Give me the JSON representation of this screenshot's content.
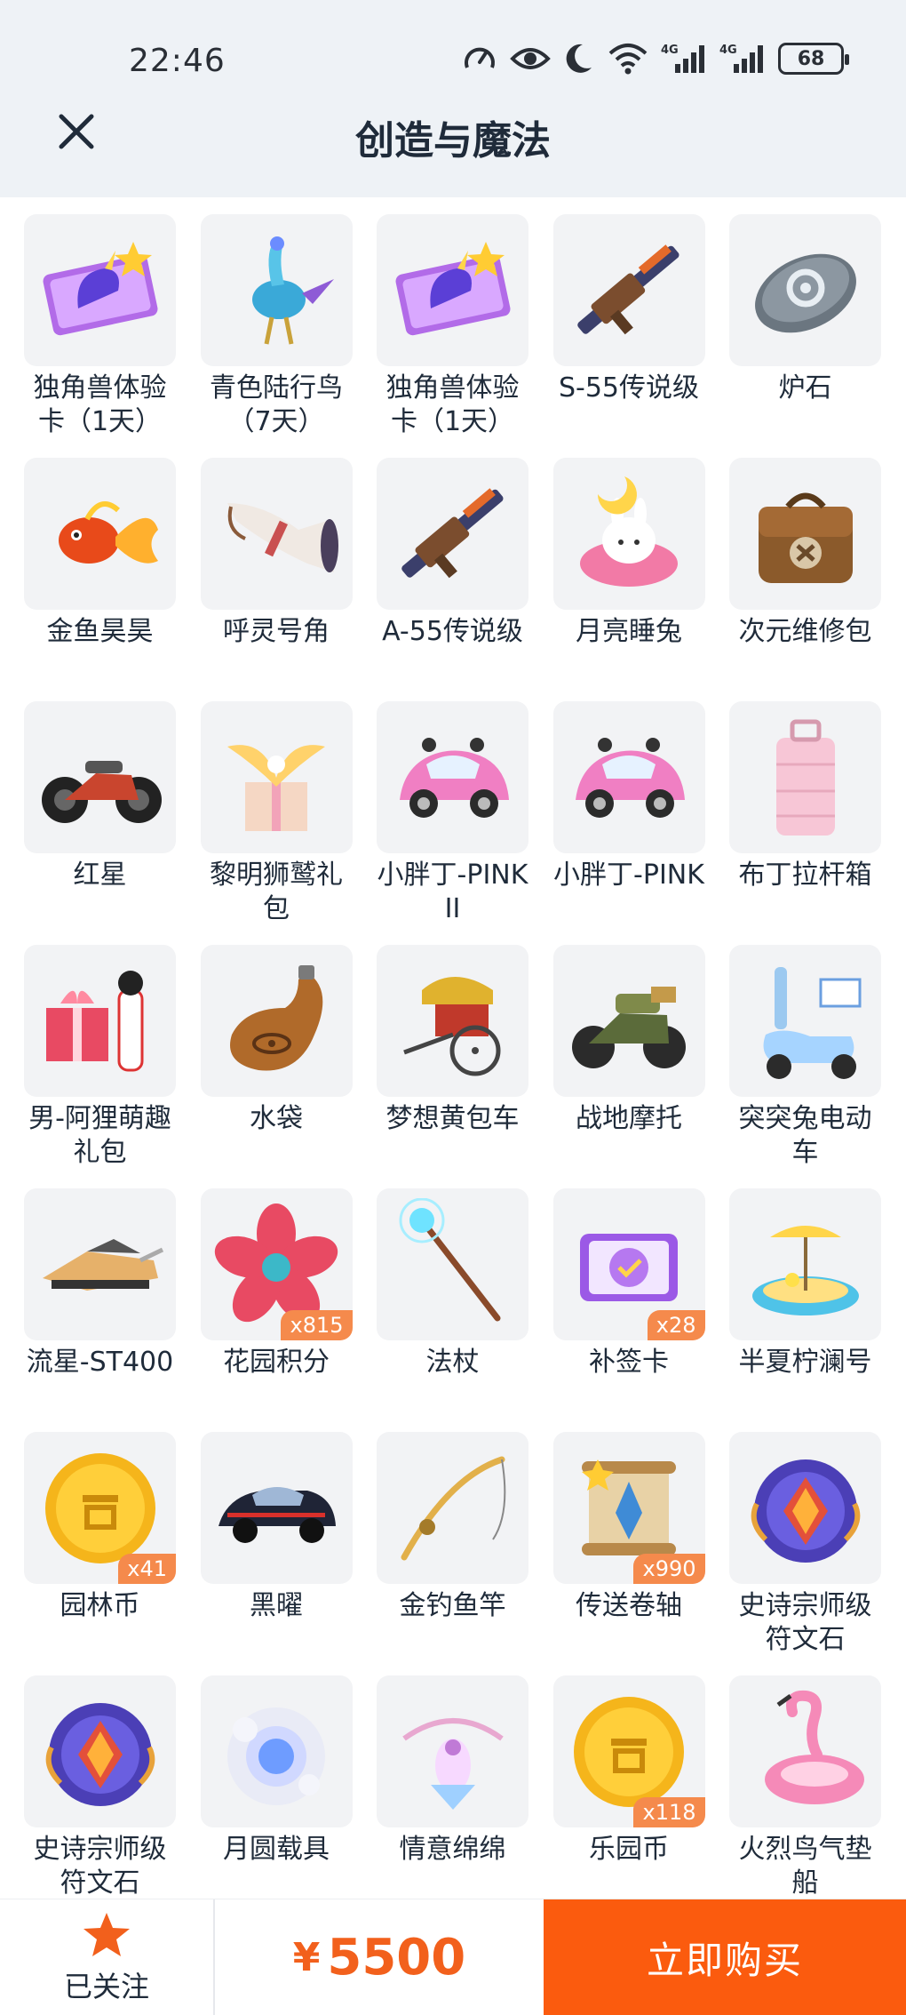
{
  "status": {
    "time": "22:46",
    "battery": "68",
    "net1": "4G",
    "net2": "4G"
  },
  "header": {
    "title": "创造与魔法"
  },
  "items": [
    {
      "name": "独角兽体验卡（1天）",
      "icon": "unicorn-card-icon",
      "badge": ""
    },
    {
      "name": "青色陆行鸟（7天）",
      "icon": "cyan-bird-icon",
      "badge": ""
    },
    {
      "name": "独角兽体验卡（1天）",
      "icon": "unicorn-card-icon",
      "badge": ""
    },
    {
      "name": "S-55传说级",
      "icon": "rifle-icon",
      "badge": ""
    },
    {
      "name": "炉石",
      "icon": "hearthstone-icon",
      "badge": ""
    },
    {
      "name": "金鱼昊昊",
      "icon": "goldfish-icon",
      "badge": ""
    },
    {
      "name": "呼灵号角",
      "icon": "horn-icon",
      "badge": ""
    },
    {
      "name": "A-55传说级",
      "icon": "rifle-icon",
      "badge": ""
    },
    {
      "name": "月亮睡兔",
      "icon": "moon-rabbit-icon",
      "badge": ""
    },
    {
      "name": "次元维修包",
      "icon": "repair-bag-icon",
      "badge": ""
    },
    {
      "name": "红星",
      "icon": "motorcycle-icon",
      "badge": ""
    },
    {
      "name": "黎明狮鹫礼包",
      "icon": "griffin-gift-icon",
      "badge": ""
    },
    {
      "name": "小胖丁-PINK II",
      "icon": "pink-car-icon",
      "badge": ""
    },
    {
      "name": "小胖丁-PINK",
      "icon": "pink-car-icon",
      "badge": ""
    },
    {
      "name": "布丁拉杆箱",
      "icon": "suitcase-icon",
      "badge": ""
    },
    {
      "name": "男-阿狸萌趣礼包",
      "icon": "gift-box-icon",
      "badge": ""
    },
    {
      "name": "水袋",
      "icon": "water-bag-icon",
      "badge": ""
    },
    {
      "name": "梦想黄包车",
      "icon": "rickshaw-icon",
      "badge": ""
    },
    {
      "name": "战地摩托",
      "icon": "military-motorbike-icon",
      "badge": ""
    },
    {
      "name": "突突兔电动车",
      "icon": "scooter-icon",
      "badge": ""
    },
    {
      "name": "流星-ST400",
      "icon": "hoverbike-icon",
      "badge": ""
    },
    {
      "name": "花园积分",
      "icon": "flower-token-icon",
      "badge": "x815"
    },
    {
      "name": "法杖",
      "icon": "staff-icon",
      "badge": ""
    },
    {
      "name": "补签卡",
      "icon": "ticket-icon",
      "badge": "x28"
    },
    {
      "name": "半夏柠澜号",
      "icon": "float-boat-icon",
      "badge": ""
    },
    {
      "name": "园林币",
      "icon": "gold-coin-icon",
      "badge": "x41"
    },
    {
      "name": "黑曜",
      "icon": "black-car-icon",
      "badge": ""
    },
    {
      "name": "金钓鱼竿",
      "icon": "fishing-rod-icon",
      "badge": ""
    },
    {
      "name": "传送卷轴",
      "icon": "scroll-icon",
      "badge": "x990"
    },
    {
      "name": "史诗宗师级符文石",
      "icon": "rune-stone-icon",
      "badge": ""
    },
    {
      "name": "史诗宗师级符文石",
      "icon": "rune-stone-icon",
      "badge": ""
    },
    {
      "name": "月圆载具",
      "icon": "moon-orb-icon",
      "badge": ""
    },
    {
      "name": "情意绵绵",
      "icon": "ribbon-ornament-icon",
      "badge": ""
    },
    {
      "name": "乐园币",
      "icon": "gold-coin-icon",
      "badge": "x118"
    },
    {
      "name": "火烈鸟气垫船",
      "icon": "flamingo-float-icon",
      "badge": ""
    }
  ],
  "footer": {
    "follow_label": "已关注",
    "currency": "¥",
    "price": "5500",
    "buy_label": "立即购买"
  },
  "colors": {
    "accent": "#fb5b0e",
    "price": "#f2601c",
    "badge": "#f58a4c",
    "star": "#f2601c"
  }
}
